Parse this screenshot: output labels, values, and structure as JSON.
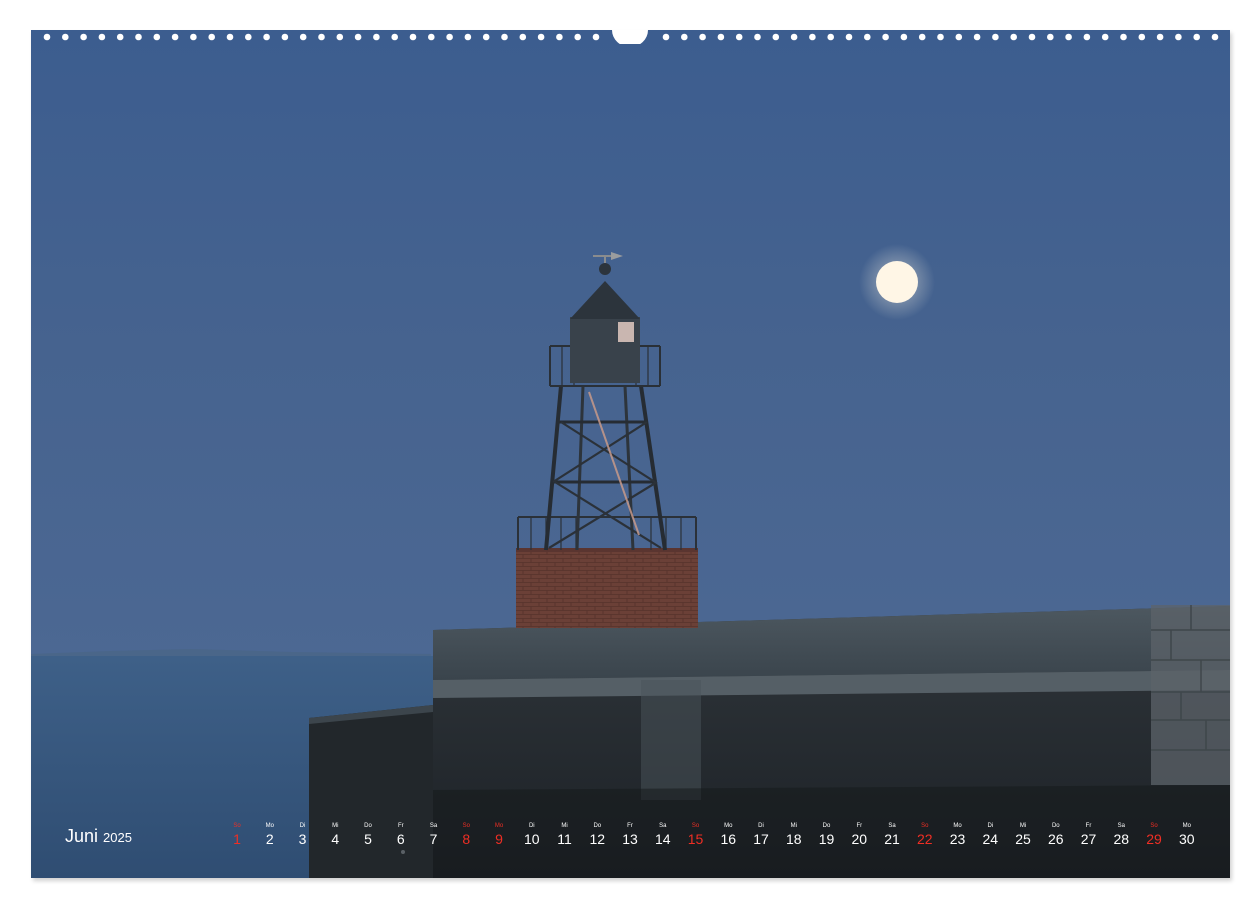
{
  "calendar": {
    "month": "Juni",
    "year": "2025",
    "days": [
      {
        "wd": "So",
        "num": "1",
        "sunday": true
      },
      {
        "wd": "Mo",
        "num": "2",
        "sunday": false
      },
      {
        "wd": "Di",
        "num": "3",
        "sunday": false
      },
      {
        "wd": "Mi",
        "num": "4",
        "sunday": false
      },
      {
        "wd": "Do",
        "num": "5",
        "sunday": false
      },
      {
        "wd": "Fr",
        "num": "6",
        "sunday": false
      },
      {
        "wd": "Sa",
        "num": "7",
        "sunday": false
      },
      {
        "wd": "So",
        "num": "8",
        "sunday": true
      },
      {
        "wd": "Mo",
        "num": "9",
        "sunday": true
      },
      {
        "wd": "Di",
        "num": "10",
        "sunday": false
      },
      {
        "wd": "Mi",
        "num": "11",
        "sunday": false
      },
      {
        "wd": "Do",
        "num": "12",
        "sunday": false
      },
      {
        "wd": "Fr",
        "num": "13",
        "sunday": false
      },
      {
        "wd": "Sa",
        "num": "14",
        "sunday": false
      },
      {
        "wd": "So",
        "num": "15",
        "sunday": true
      },
      {
        "wd": "Mo",
        "num": "16",
        "sunday": false
      },
      {
        "wd": "Di",
        "num": "17",
        "sunday": false
      },
      {
        "wd": "Mi",
        "num": "18",
        "sunday": false
      },
      {
        "wd": "Do",
        "num": "19",
        "sunday": false
      },
      {
        "wd": "Fr",
        "num": "20",
        "sunday": false
      },
      {
        "wd": "Sa",
        "num": "21",
        "sunday": false
      },
      {
        "wd": "So",
        "num": "22",
        "sunday": true
      },
      {
        "wd": "Mo",
        "num": "23",
        "sunday": false
      },
      {
        "wd": "Di",
        "num": "24",
        "sunday": false
      },
      {
        "wd": "Mi",
        "num": "25",
        "sunday": false
      },
      {
        "wd": "Do",
        "num": "26",
        "sunday": false
      },
      {
        "wd": "Fr",
        "num": "27",
        "sunday": false
      },
      {
        "wd": "Sa",
        "num": "28",
        "sunday": false
      },
      {
        "wd": "So",
        "num": "29",
        "sunday": true
      },
      {
        "wd": "Mo",
        "num": "30",
        "sunday": false
      }
    ]
  },
  "colors": {
    "sky_top": "#3d5f90",
    "sky_bottom": "#4b6994",
    "sea": "#3f6289",
    "holiday_red": "#ef2e24",
    "moon": "#fff6e6",
    "brick": "#6a3f36"
  },
  "scene": {
    "subject": "lighthouse-icon",
    "moon": "full-moon-icon"
  }
}
